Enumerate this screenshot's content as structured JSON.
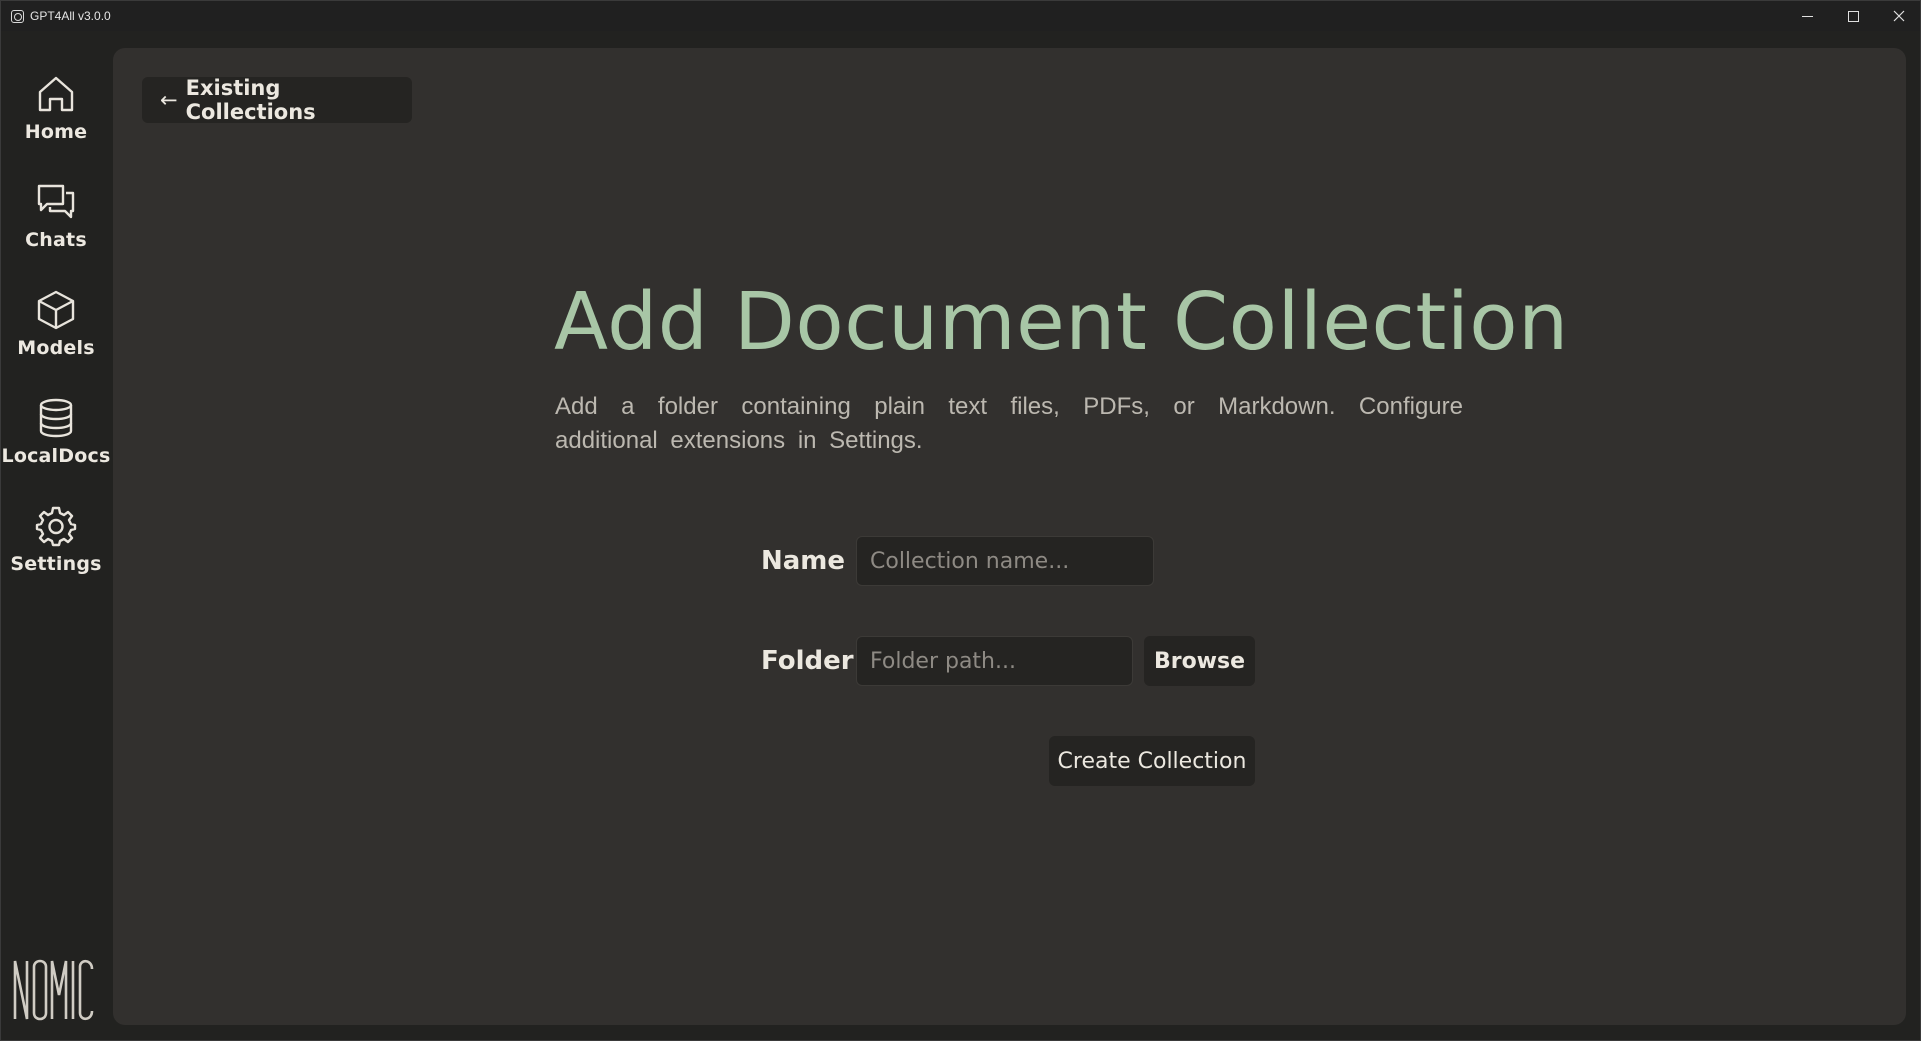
{
  "window": {
    "title": "GPT4All v3.0.0"
  },
  "sidebar": {
    "items": [
      {
        "label": "Home",
        "icon": "home-icon"
      },
      {
        "label": "Chats",
        "icon": "chat-bubbles-icon"
      },
      {
        "label": "Models",
        "icon": "cube-icon"
      },
      {
        "label": "LocalDocs",
        "icon": "database-icon"
      },
      {
        "label": "Settings",
        "icon": "gear-icon"
      }
    ],
    "logo": "NOMIC"
  },
  "main": {
    "back_button": {
      "arrow": "←",
      "label": "Existing Collections"
    },
    "heading": "Add Document Collection",
    "description": "Add a folder containing plain text files, PDFs, or Markdown. Configure additional extensions in Settings.",
    "form": {
      "name_label": "Name",
      "name_placeholder": "Collection name...",
      "folder_label": "Folder",
      "folder_placeholder": "Folder path...",
      "browse_label": "Browse",
      "create_label": "Create Collection"
    }
  },
  "colors": {
    "accent": "#a8c6a6",
    "panel": "#32302e",
    "sidebar": "#222220",
    "button": "#252422"
  }
}
